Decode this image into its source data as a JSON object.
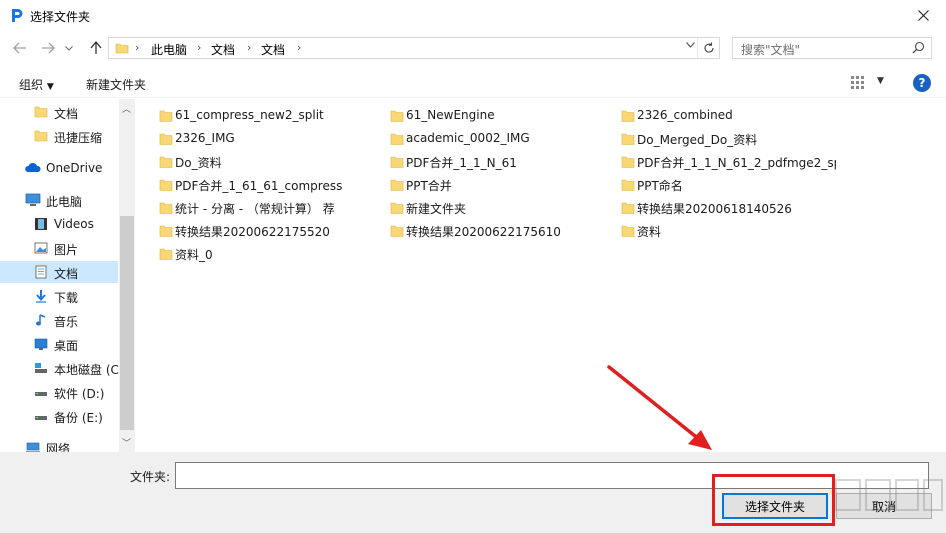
{
  "window": {
    "title": "选择文件夹"
  },
  "address": {
    "crumbs": [
      "此电脑",
      "文档",
      "文档"
    ]
  },
  "search": {
    "placeholder": "搜索\"文档\""
  },
  "toolbar": {
    "organize": "组织",
    "new_folder": "新建文件夹",
    "help": "?"
  },
  "sidebar": {
    "items": [
      {
        "label": "文档",
        "icon": "folder-icon"
      },
      {
        "label": "迅捷压缩",
        "icon": "folder-icon"
      },
      {
        "label": "OneDrive",
        "icon": "cloud-icon"
      },
      {
        "label": "此电脑",
        "icon": "computer-icon"
      },
      {
        "label": "Videos",
        "icon": "video-icon"
      },
      {
        "label": "图片",
        "icon": "pictures-icon"
      },
      {
        "label": "文档",
        "icon": "documents-icon",
        "selected": true
      },
      {
        "label": "下载",
        "icon": "download-icon"
      },
      {
        "label": "音乐",
        "icon": "music-icon"
      },
      {
        "label": "桌面",
        "icon": "desktop-icon"
      },
      {
        "label": "本地磁盘 (C",
        "icon": "drive-c-icon"
      },
      {
        "label": "软件 (D:)",
        "icon": "drive-icon"
      },
      {
        "label": "备份 (E:)",
        "icon": "drive-icon"
      },
      {
        "label": "网络",
        "icon": "network-icon"
      }
    ]
  },
  "files": {
    "col1": [
      "61_compress_new2_split",
      "2326_IMG",
      "Do_资料",
      "PDF合并_1_61_61_compress",
      "统计 - 分离 - （常规计算） 荐",
      "转换结果20200622175520",
      "资料_0"
    ],
    "col2": [
      "61_NewEngine",
      "academic_0002_IMG",
      "PDF合并_1_1_N_61",
      "PPT合并",
      "新建文件夹",
      "转换结果20200622175610"
    ],
    "col3": [
      "2326_combined",
      "Do_Merged_Do_资料",
      "PDF合并_1_1_N_61_2_pdfmge2_sp...",
      "PPT命名",
      "转换结果20200618140526",
      "资料"
    ]
  },
  "bottom": {
    "folder_label": "文件夹:",
    "folder_value": "",
    "select_button": "选择文件夹",
    "cancel_button": "取消"
  },
  "colors": {
    "accent": "#0078d7",
    "annotation": "#e02020",
    "folder": "#f8d775",
    "selected": "#cce8ff"
  }
}
